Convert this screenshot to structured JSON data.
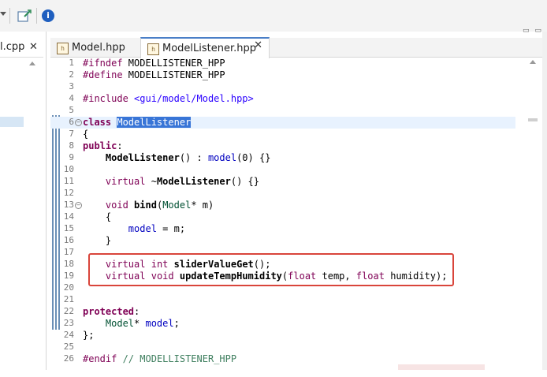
{
  "toolbar": {
    "info_label": "i"
  },
  "left_editor": {
    "tab_label": "l.cpp",
    "close_label": "✕"
  },
  "tabs": [
    {
      "label": "Model.hpp",
      "icon": "h"
    },
    {
      "label": "ModelListener.hpp",
      "icon": "h",
      "close": "✕"
    }
  ],
  "window_controls": "▭ ▭",
  "code": {
    "line_numbers": [
      "1",
      "2",
      "3",
      "4",
      "5",
      "6",
      "7",
      "8",
      "9",
      "10",
      "11",
      "12",
      "13",
      "14",
      "15",
      "16",
      "17",
      "18",
      "19",
      "20",
      "21",
      "22",
      "23",
      "24",
      "25",
      "26"
    ]
  },
  "colors": {
    "keyword": "#7f0055",
    "include": "#2a00ff",
    "comment": "#3f7f5f",
    "selection": "#3875d7",
    "highlight_box": "#d9453b",
    "tab_accent": "#4a7fc7"
  }
}
